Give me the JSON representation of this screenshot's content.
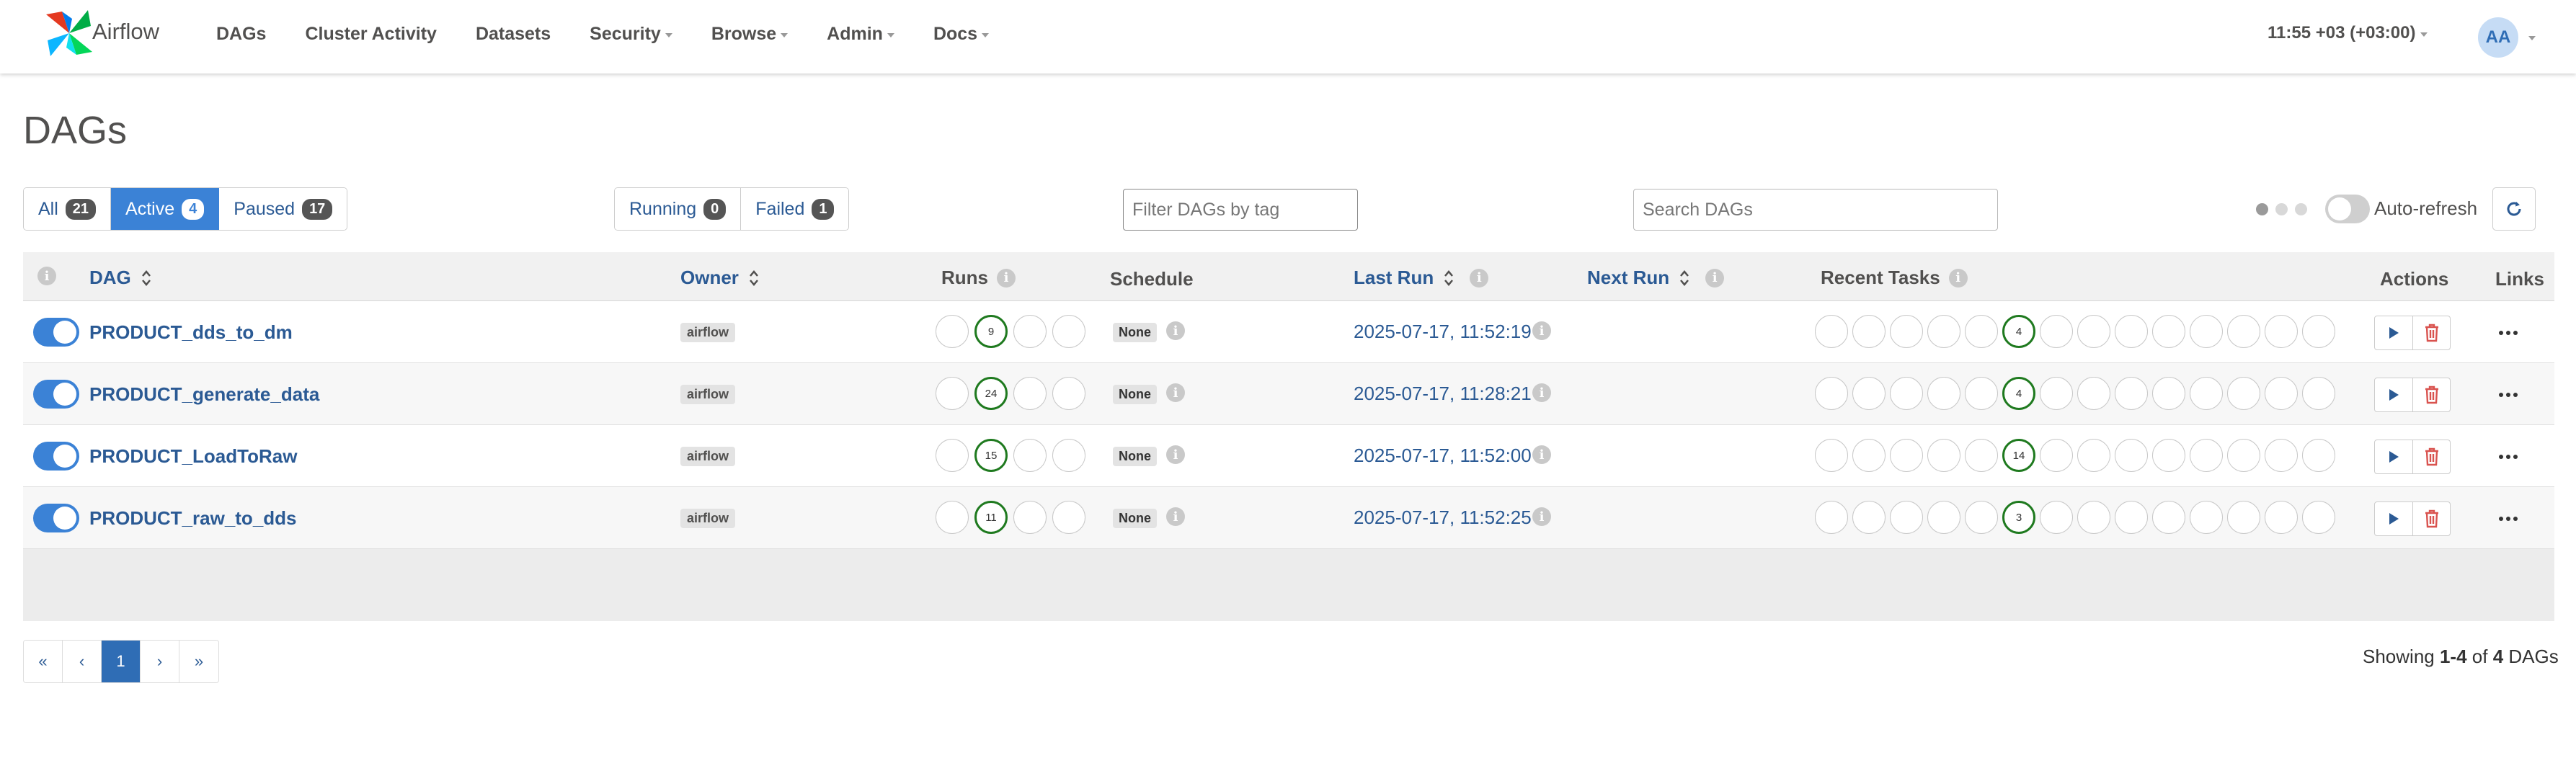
{
  "app": {
    "name": "Airflow"
  },
  "nav": {
    "items": [
      {
        "label": "DAGs",
        "dropdown": false,
        "name": "nav-dags"
      },
      {
        "label": "Cluster Activity",
        "dropdown": false,
        "name": "nav-cluster-activity"
      },
      {
        "label": "Datasets",
        "dropdown": false,
        "name": "nav-datasets"
      },
      {
        "label": "Security",
        "dropdown": true,
        "name": "nav-security"
      },
      {
        "label": "Browse",
        "dropdown": true,
        "name": "nav-browse"
      },
      {
        "label": "Admin",
        "dropdown": true,
        "name": "nav-admin"
      },
      {
        "label": "Docs",
        "dropdown": true,
        "name": "nav-docs"
      }
    ],
    "time": "11:55 +03 (+03:00)",
    "user_initials": "AA"
  },
  "page_title": "DAGs",
  "status_filters": [
    {
      "label": "All",
      "count": "21",
      "active": false
    },
    {
      "label": "Active",
      "count": "4",
      "active": true
    },
    {
      "label": "Paused",
      "count": "17",
      "active": false
    }
  ],
  "run_filters": [
    {
      "label": "Running",
      "count": "0"
    },
    {
      "label": "Failed",
      "count": "1"
    }
  ],
  "tag_filter": {
    "placeholder": "Filter DAGs by tag"
  },
  "search": {
    "placeholder": "Search DAGs"
  },
  "auto_refresh": {
    "label": "Auto-refresh",
    "enabled": false
  },
  "columns": {
    "dag": "DAG",
    "owner": "Owner",
    "runs": "Runs",
    "schedule": "Schedule",
    "last_run": "Last Run",
    "next_run": "Next Run",
    "recent_tasks": "Recent Tasks",
    "actions": "Actions",
    "links": "Links"
  },
  "dags": [
    {
      "name": "PRODUCT_dds_to_dm",
      "owner": "airflow",
      "runs_success": "9",
      "schedule": "None",
      "last_run": "2025-07-17, 11:52:19",
      "tasks_success": "4",
      "paused": false
    },
    {
      "name": "PRODUCT_generate_data",
      "owner": "airflow",
      "runs_success": "24",
      "schedule": "None",
      "last_run": "2025-07-17, 11:28:21",
      "tasks_success": "4",
      "paused": false
    },
    {
      "name": "PRODUCT_LoadToRaw",
      "owner": "airflow",
      "runs_success": "15",
      "schedule": "None",
      "last_run": "2025-07-17, 11:52:00",
      "tasks_success": "14",
      "paused": false
    },
    {
      "name": "PRODUCT_raw_to_dds",
      "owner": "airflow",
      "runs_success": "11",
      "schedule": "None",
      "last_run": "2025-07-17, 11:52:25",
      "tasks_success": "3",
      "paused": false
    }
  ],
  "pagination": {
    "first": "«",
    "prev": "‹",
    "current": "1",
    "next": "›",
    "last": "»"
  },
  "showing": {
    "prefix": "Showing ",
    "range": "1-4",
    "middle": " of ",
    "total": "4",
    "suffix": " DAGs"
  },
  "colors": {
    "accent": "#3b82d6",
    "link": "#2b5a94",
    "success": "#1f7a1f",
    "danger": "#d9534f"
  }
}
